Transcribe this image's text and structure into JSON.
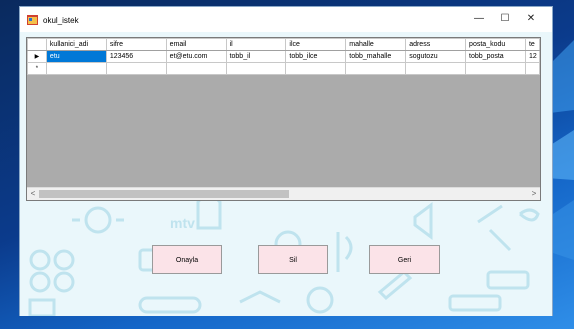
{
  "window": {
    "title": "okul_istek",
    "min_glyph": "—",
    "max_glyph": "☐",
    "close_glyph": "✕"
  },
  "grid": {
    "columns": [
      "kullanici_adi",
      "sifre",
      "email",
      "il",
      "ilce",
      "mahalle",
      "adress",
      "posta_kodu",
      "te"
    ],
    "rows": [
      {
        "marker": "▶",
        "cells": [
          "etu",
          "123456",
          "et@etu.com",
          "tobb_il",
          "tobb_ilce",
          "tobb_mahalle",
          "sogutozu",
          "tobb_posta",
          "12"
        ]
      },
      {
        "marker": "*",
        "cells": [
          "",
          "",
          "",
          "",
          "",
          "",
          "",
          "",
          ""
        ]
      }
    ],
    "scroll_left": "<",
    "scroll_right": ">"
  },
  "buttons": {
    "approve": "Onayla",
    "delete": "Sil",
    "back": "Geri"
  },
  "background": {
    "logo_text": "mtv"
  }
}
